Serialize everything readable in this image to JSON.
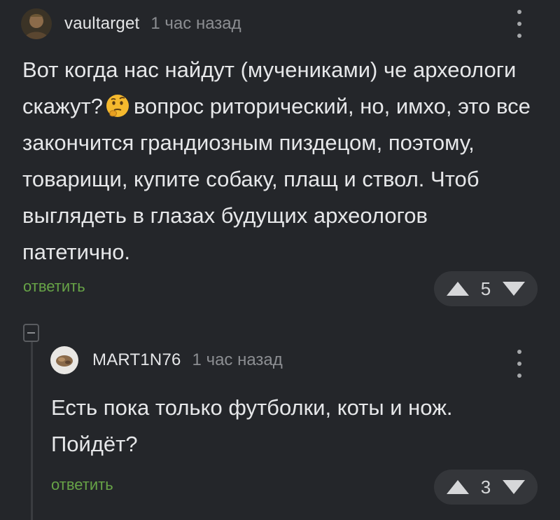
{
  "comments": [
    {
      "username": "vaultarget",
      "time": "1 час назад",
      "text_part1": "Вот когда нас найдут (мучениками) че археологи скажут?",
      "emoji": "thinking-face",
      "text_part2": "вопрос риторический, но, имхо, это все закончится грандиозным пиздецом, поэтому, товарищи, купите собаку, плащ и ствол. Чтоб выглядеть в глазах будущих археологов патетично.",
      "reply_label": "ответить",
      "votes": "5"
    },
    {
      "username": "MART1N76",
      "time": "1 час назад",
      "text": "Есть пока только футболки, коты и нож. Пойдёт?",
      "reply_label": "ответить",
      "votes": "3"
    }
  ],
  "colors": {
    "background": "#24262a",
    "reply_link": "#67a347",
    "vote_pill": "#34363a",
    "muted_text": "#8c8e92"
  }
}
